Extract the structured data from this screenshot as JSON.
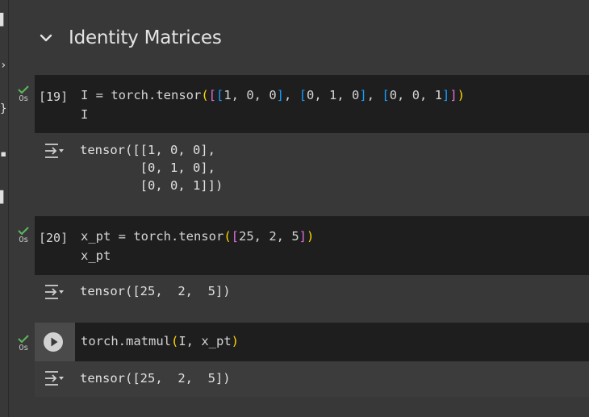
{
  "section": {
    "title": "Identity Matrices"
  },
  "cells": [
    {
      "exec": "[19]",
      "time": "0s",
      "code_line1_prefix": "I = torch.tensor",
      "code_line2": "I",
      "output": "tensor([[1, 0, 0],\n        [0, 1, 0],\n        [0, 0, 1]])"
    },
    {
      "exec": "[20]",
      "time": "0s",
      "code_line1_prefix": "x_pt = torch.tensor",
      "code_line2": "x_pt",
      "output": "tensor([25,  2,  5])"
    },
    {
      "time": "0s",
      "code_line1": "torch.matmul",
      "args": "I, x_pt",
      "output": "tensor([25,  2,  5])"
    }
  ],
  "colors": {
    "bracket_level1": "#ffd700",
    "bracket_level2": "#da70d6",
    "bracket_level3": "#179fff",
    "success_check": "#5cb85c"
  },
  "icons": [
    "chevron-down-icon",
    "check-icon",
    "output-toggle-icon",
    "run-cell-icon"
  ]
}
